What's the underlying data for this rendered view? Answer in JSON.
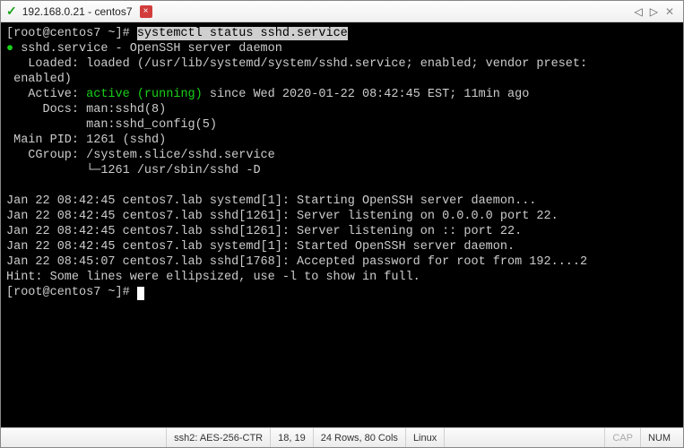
{
  "window": {
    "title": "192.168.0.21 - centos7"
  },
  "terminal": {
    "prompt": "[root@centos7 ~]# ",
    "command": "systemctl status sshd.service",
    "line1a": "● ",
    "line1b": "sshd.service - OpenSSH server daemon",
    "line2": "   Loaded: loaded (/usr/lib/systemd/system/sshd.service; enabled; vendor preset:",
    "line3": " enabled)",
    "line4a": "   Active: ",
    "line4b": "active (running)",
    "line4c": " since Wed 2020-01-22 08:42:45 EST; 11min ago",
    "line5": "     Docs: man:sshd(8)",
    "line6": "           man:sshd_config(5)",
    "line7": " Main PID: 1261 (sshd)",
    "line8": "   CGroup: /system.slice/sshd.service",
    "line9": "           └─1261 /usr/sbin/sshd -D",
    "log1": "Jan 22 08:42:45 centos7.lab systemd[1]: Starting OpenSSH server daemon...",
    "log2": "Jan 22 08:42:45 centos7.lab sshd[1261]: Server listening on 0.0.0.0 port 22.",
    "log3": "Jan 22 08:42:45 centos7.lab sshd[1261]: Server listening on :: port 22.",
    "log4": "Jan 22 08:42:45 centos7.lab systemd[1]: Started OpenSSH server daemon.",
    "log5": "Jan 22 08:45:07 centos7.lab sshd[1768]: Accepted password for root from 192....2",
    "hint": "Hint: Some lines were ellipsized, use -l to show in full.",
    "prompt2": "[root@centos7 ~]# "
  },
  "status": {
    "proto": "ssh2: AES-256-CTR",
    "cursor": "18, 19",
    "size": "24 Rows, 80 Cols",
    "os": "Linux",
    "cap": "CAP",
    "num": "NUM"
  }
}
